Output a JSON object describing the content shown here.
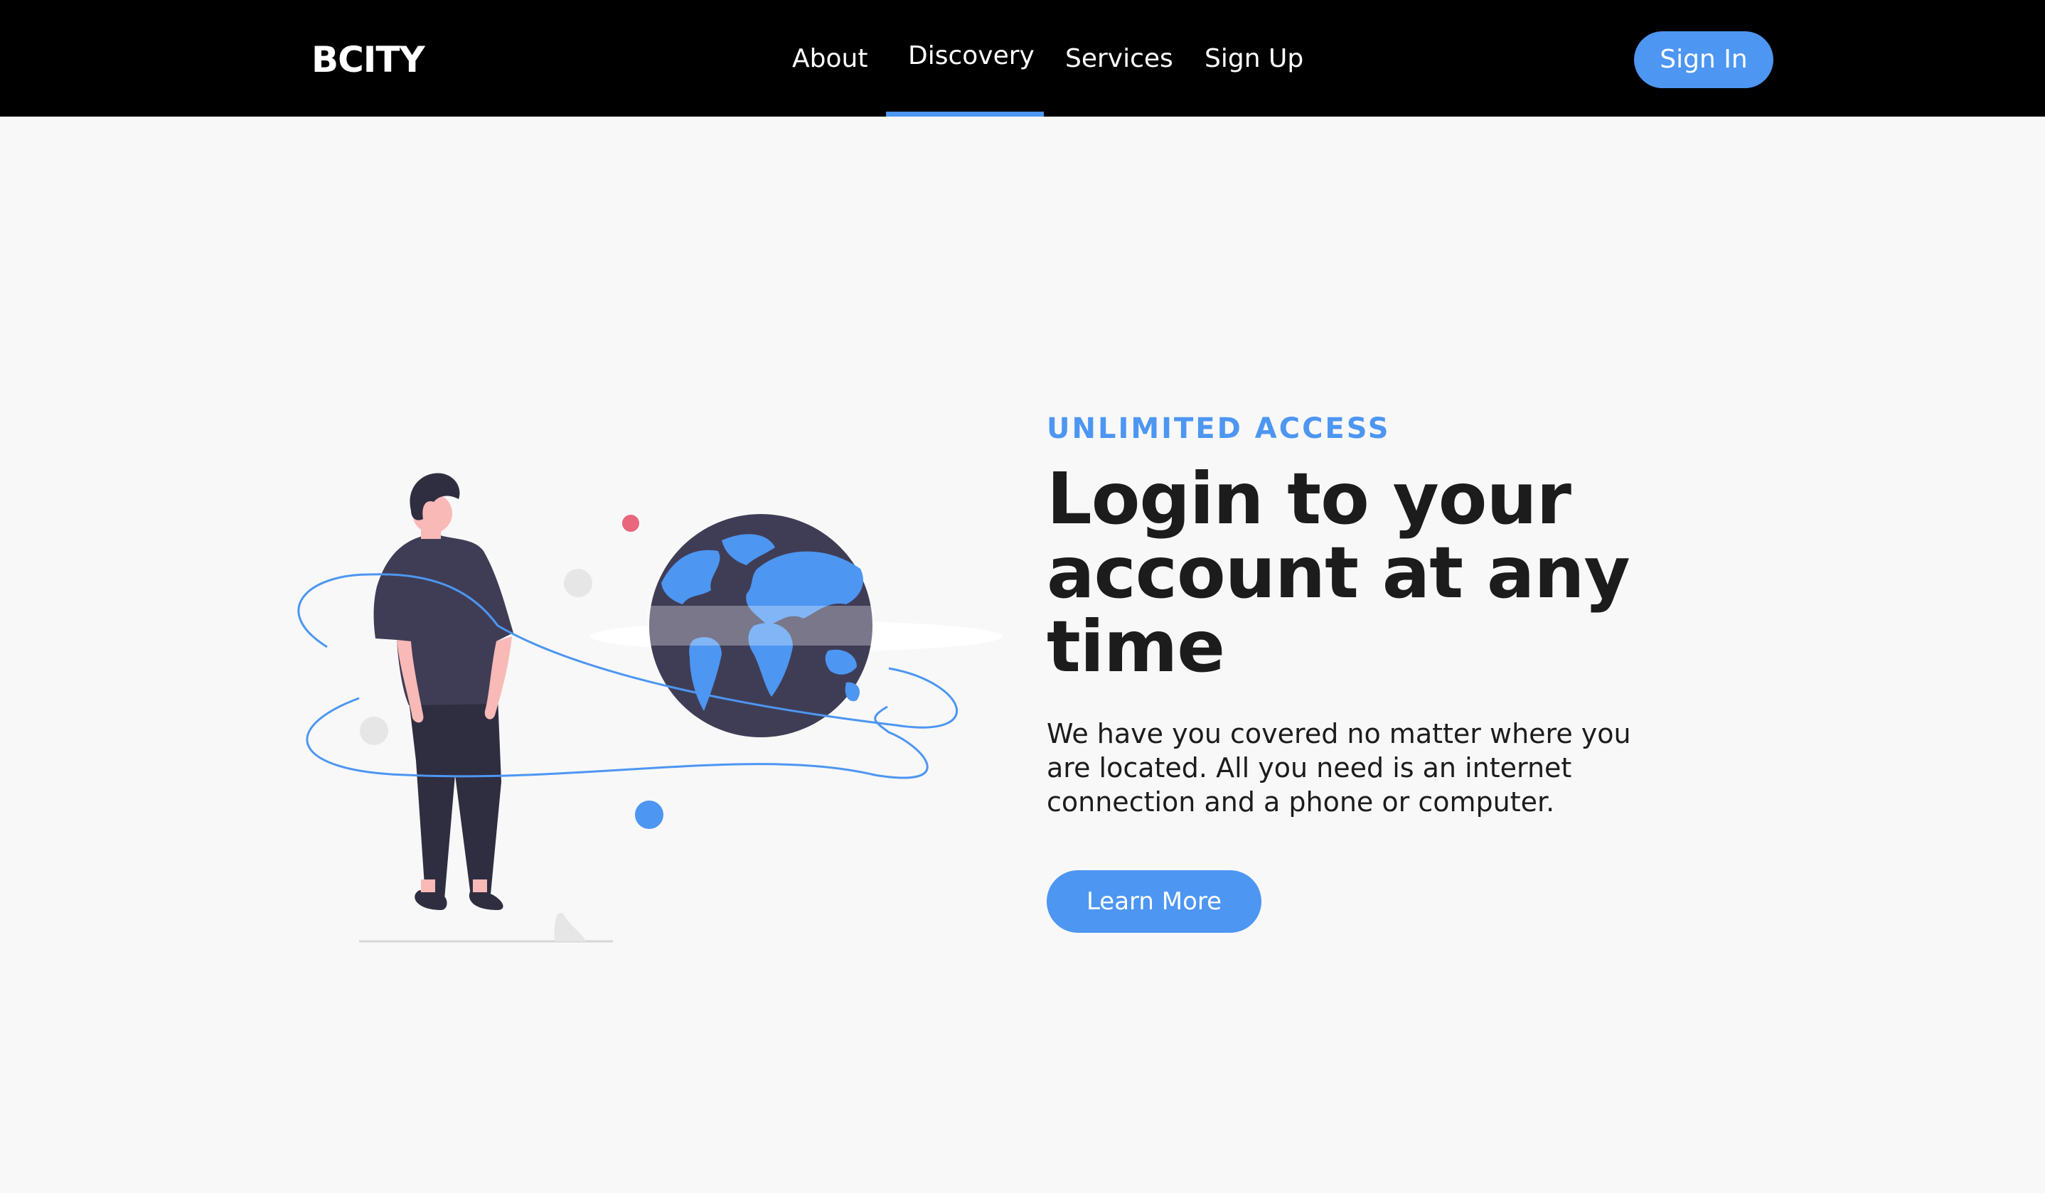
{
  "header": {
    "brand": "BCITY",
    "nav": [
      {
        "label": "About"
      },
      {
        "label": "Discovery",
        "active": true
      },
      {
        "label": "Services"
      },
      {
        "label": "Sign Up"
      }
    ],
    "signin_label": "Sign In"
  },
  "hero": {
    "eyebrow": "UNLIMITED ACCESS",
    "title": "Login to your account at any time",
    "description": "We have you covered no matter where you are located. All you need is an internet connection and a phone or computer.",
    "cta_label": "Learn More"
  },
  "colors": {
    "accent": "#4d96f2",
    "navbar_bg": "#000000",
    "page_bg": "#f8f8f8",
    "text_dark": "#1c1c1c",
    "figure_dark": "#3f3d56",
    "dot_pink": "#e8677d"
  },
  "illustration": {
    "icon": "person-with-globe-illustration"
  }
}
